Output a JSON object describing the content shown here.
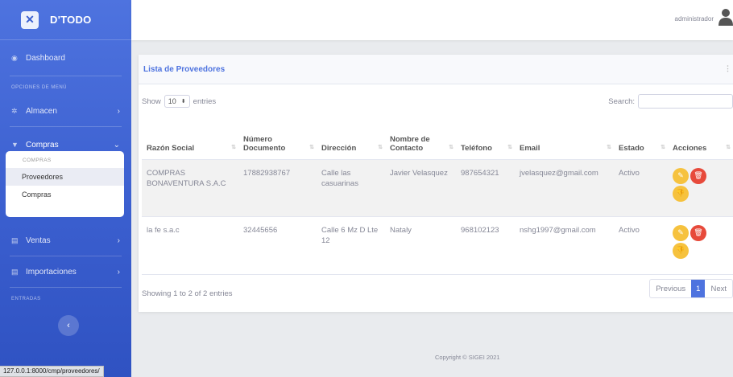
{
  "brand": {
    "name": "D'TODO"
  },
  "sidebar": {
    "dashboard": "Dashboard",
    "section_menu": "OPCIONES DE MENÚ",
    "almacen": "Almacen",
    "compras": "Compras",
    "submenu_header": "COMPRAS",
    "submenu_items": [
      "Proveedores",
      "Compras"
    ],
    "ventas": "Ventas",
    "importaciones": "Importaciones",
    "section_entradas": "ENTRADAS"
  },
  "status_url": "127.0.0.1:8000/cmp/proveedores/",
  "topbar": {
    "user": "administrador"
  },
  "card": {
    "title": "Lista de Proveedores",
    "show_label": "Show",
    "show_value": "10",
    "entries_label": "entries",
    "search_label": "Search:",
    "info": "Showing 1 to 2 of 2 entries"
  },
  "table": {
    "headers": [
      "Razón Social",
      "Número Documento",
      "Dirección",
      "Nombre de Contacto",
      "Teléfono",
      "Email",
      "Estado",
      "Acciones"
    ],
    "rows": [
      [
        "COMPRAS BONAVENTURA S.A.C",
        "17882938767",
        "Calle las casuarinas",
        "Javier Velasquez",
        "987654321",
        "jvelasquez@gmail.com",
        "Activo"
      ],
      [
        "la fe s.a.c",
        "32445656",
        "Calle 6 Mz D Lte 12",
        "Nataly",
        "968102123",
        "nshg1997@gmail.com",
        "Activo"
      ]
    ]
  },
  "pagination": {
    "previous": "Previous",
    "current": "1",
    "next": "Next"
  },
  "footer": {
    "copyright": "Copyright © SIGEI 2021"
  },
  "colors": {
    "primary": "#4e73df",
    "warning": "#f6c23e",
    "danger": "#e74a3b"
  }
}
